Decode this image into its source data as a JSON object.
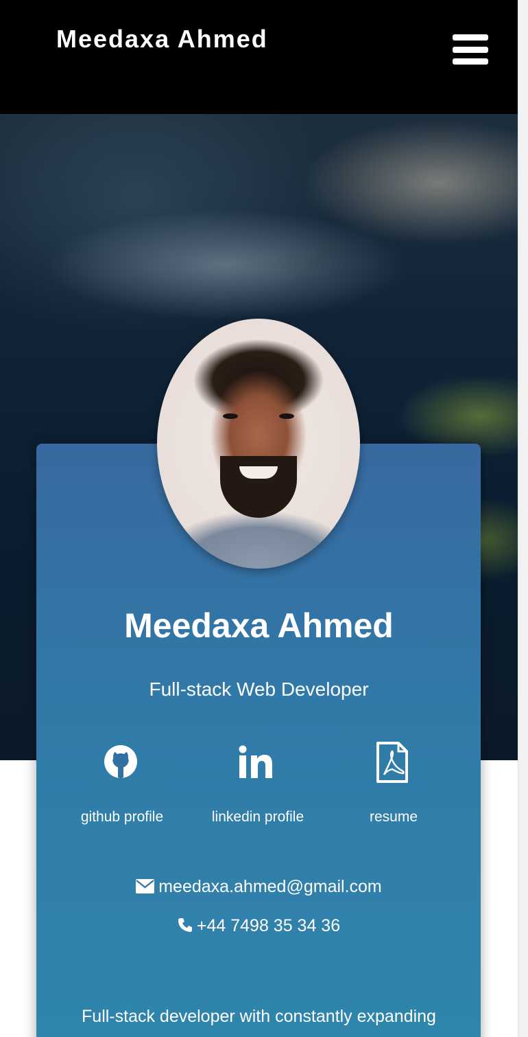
{
  "navbar": {
    "brand": "Meedaxa Ahmed",
    "menu_icon": "hamburger-menu-icon"
  },
  "profile": {
    "name": "Meedaxa Ahmed",
    "role": "Full-stack Web Developer"
  },
  "links": [
    {
      "label": "github profile",
      "icon": "github-icon"
    },
    {
      "label": "linkedin profile",
      "icon": "linkedin-icon"
    },
    {
      "label": "resume",
      "icon": "pdf-file-icon"
    }
  ],
  "contact": {
    "email": "meedaxa.ahmed@gmail.com",
    "email_icon": "envelope-icon",
    "phone": "+44 7498 35 34 36",
    "phone_icon": "phone-icon"
  },
  "about": {
    "text": "Full-stack developer with constantly expanding"
  },
  "colors": {
    "navbar": "#000000",
    "card_top": "#3869a0",
    "card_bottom": "#2f86ad",
    "text": "#ffffff"
  }
}
